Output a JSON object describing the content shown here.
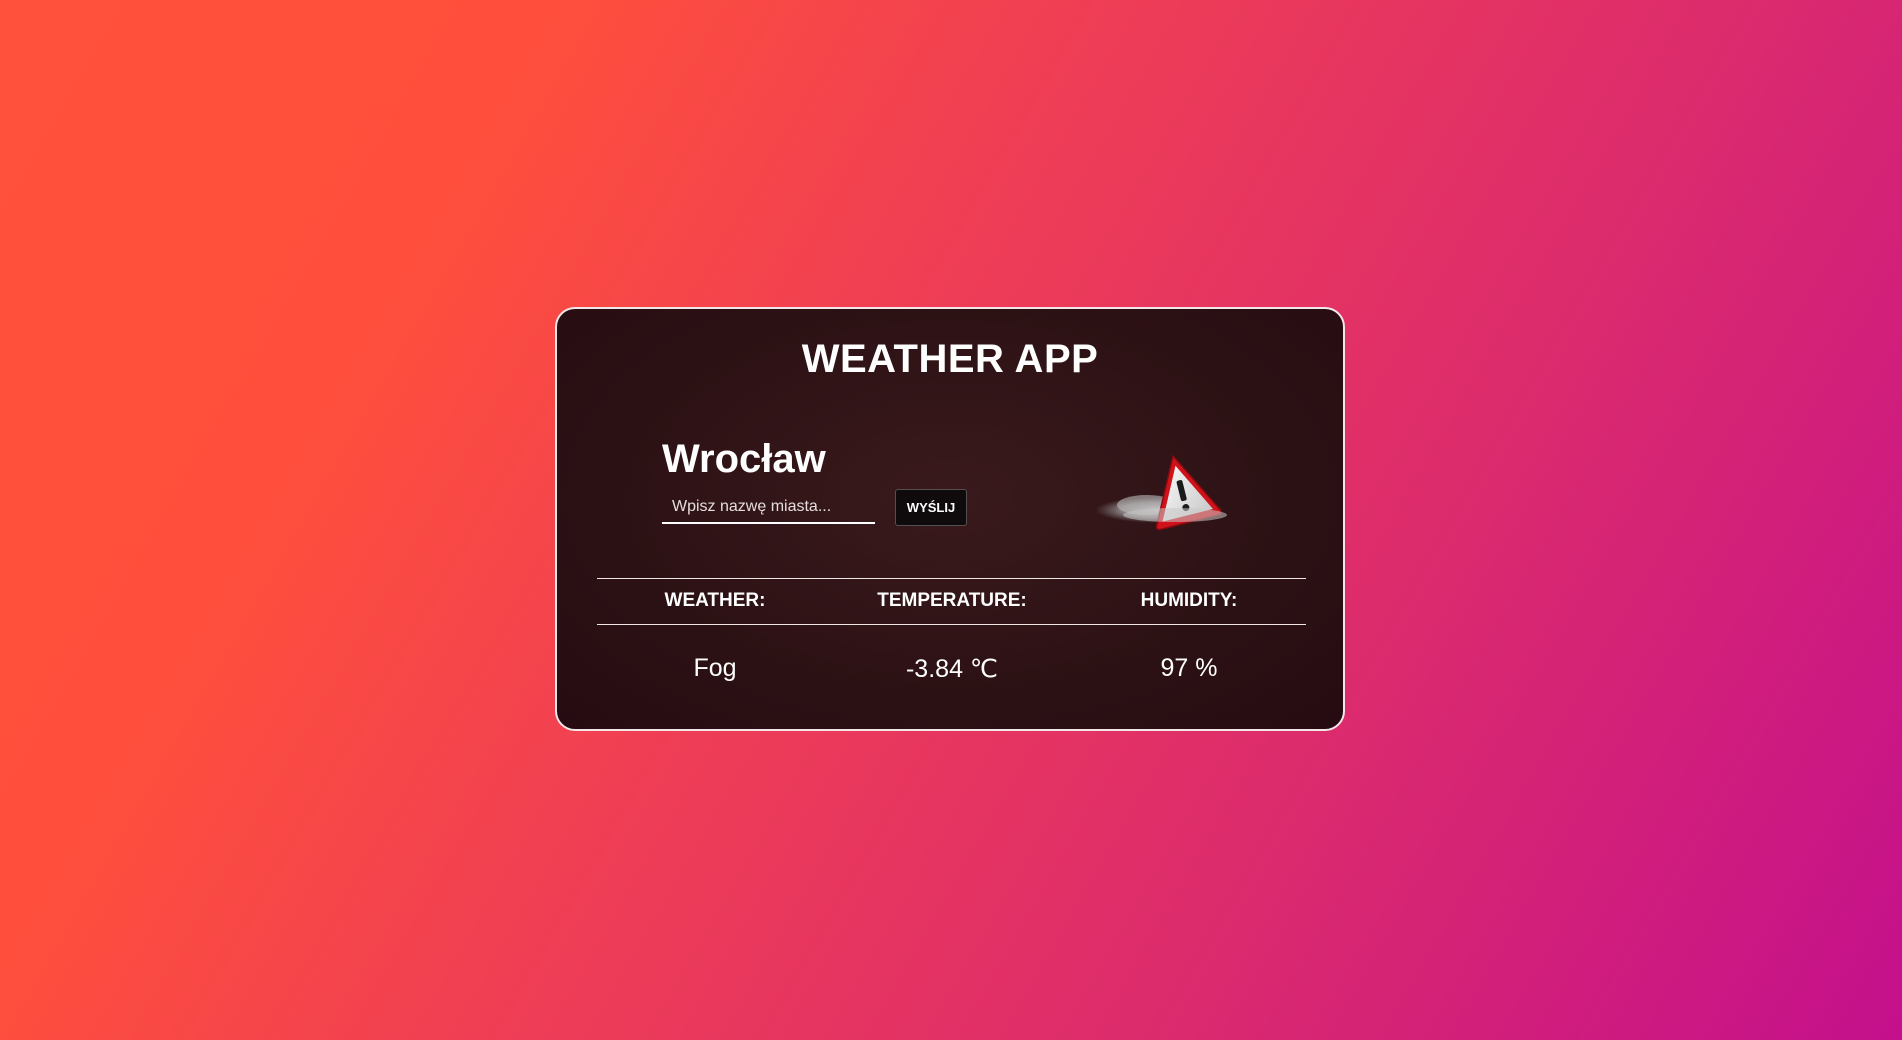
{
  "app": {
    "title": "WEATHER APP"
  },
  "location": {
    "city": "Wrocław"
  },
  "search": {
    "placeholder": "Wpisz nazwę miasta...",
    "value": "",
    "button_label": "WYŚLIJ"
  },
  "icon": {
    "name": "warning-fog-icon"
  },
  "table": {
    "headers": {
      "weather": "WEATHER:",
      "temperature": "TEMPERATURE:",
      "humidity": "HUMIDITY:"
    },
    "values": {
      "weather": "Fog",
      "temperature": "-3.84",
      "temperature_unit": "℃",
      "humidity": "97 %"
    }
  },
  "colors": {
    "card_border": "#f3e6e8",
    "card_background": "#2c1114",
    "warning_red": "#d0121b",
    "gradient_start": "#ff513b",
    "gradient_end": "#c4108c"
  }
}
